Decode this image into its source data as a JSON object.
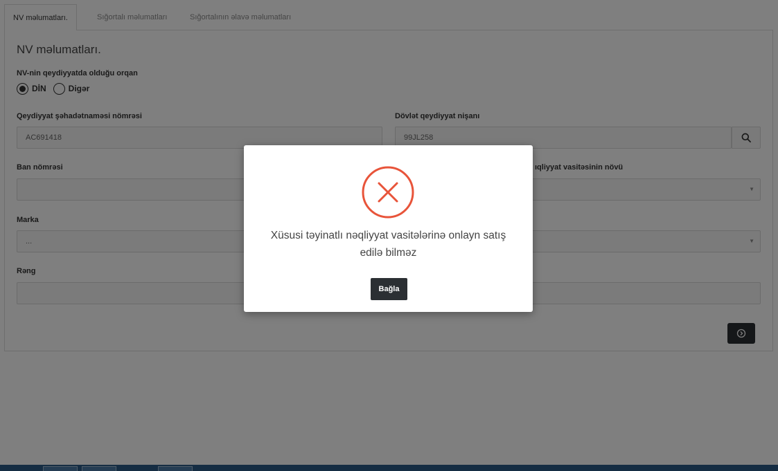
{
  "tabs": [
    {
      "label": "NV məlumatları."
    },
    {
      "label": "Sığortalı məlumatları"
    },
    {
      "label": "Sığortalının əlavə məlumatları"
    }
  ],
  "form": {
    "section_title": "NV məlumatları.",
    "registry_label": "NV-nin qeydiyyatda olduğu orqan",
    "registry_options": [
      {
        "label": "DİN",
        "selected": true
      },
      {
        "label": "Digər",
        "selected": false
      }
    ],
    "certificate_label": "Qeydiyyat şəhadətnaməsi nömrəsi",
    "certificate_value": "AC691418",
    "plate_label": "Dövlət qeydiyyat nişanı",
    "plate_value": "99JL258",
    "ban_label": "Ban nömrəsi",
    "ban_value": "",
    "vehicle_type_label": "ıqliyyat vasitəsinin növü",
    "brand_label": "Marka",
    "brand_placeholder": "...",
    "color_label": "Rəng",
    "color_value": ""
  },
  "modal": {
    "icon": "error-x-circle-icon",
    "message": "Xüsusi təyinatlı nəqliyyat vasitələrinə onlayn satış edilə bilməz",
    "close_label": "Bağla"
  },
  "colors": {
    "error": "#e8543a",
    "button_dark": "#2b2f33"
  }
}
